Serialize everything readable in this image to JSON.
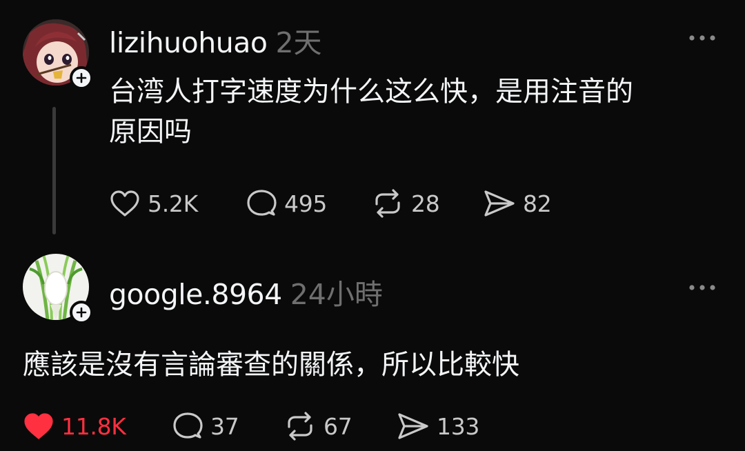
{
  "colors": {
    "background": "#0a0a0a",
    "text_primary": "#f3f5f7",
    "text_secondary": "#6f6f6f",
    "like_active": "#ff3040"
  },
  "posts": [
    {
      "username": "lizihuohuao",
      "time": "2天",
      "text_line_1": "台湾人打字速度为什么这么快，是用注音的",
      "text_line_2": "原因吗",
      "likes": "5.2K",
      "liked": false,
      "replies": "495",
      "reposts": "28",
      "shares": "82",
      "icons": [
        "heart-icon",
        "comment-icon",
        "repost-icon",
        "share-icon",
        "more-icon",
        "plus-icon"
      ]
    },
    {
      "username": "google.8964",
      "time": "24小時",
      "text": "應該是沒有言論審查的關係，所以比較快",
      "likes": "11.8K",
      "liked": true,
      "replies": "37",
      "reposts": "67",
      "shares": "133",
      "icons": [
        "heart-filled-icon",
        "comment-icon",
        "repost-icon",
        "share-icon",
        "more-icon",
        "plus-icon"
      ]
    }
  ]
}
